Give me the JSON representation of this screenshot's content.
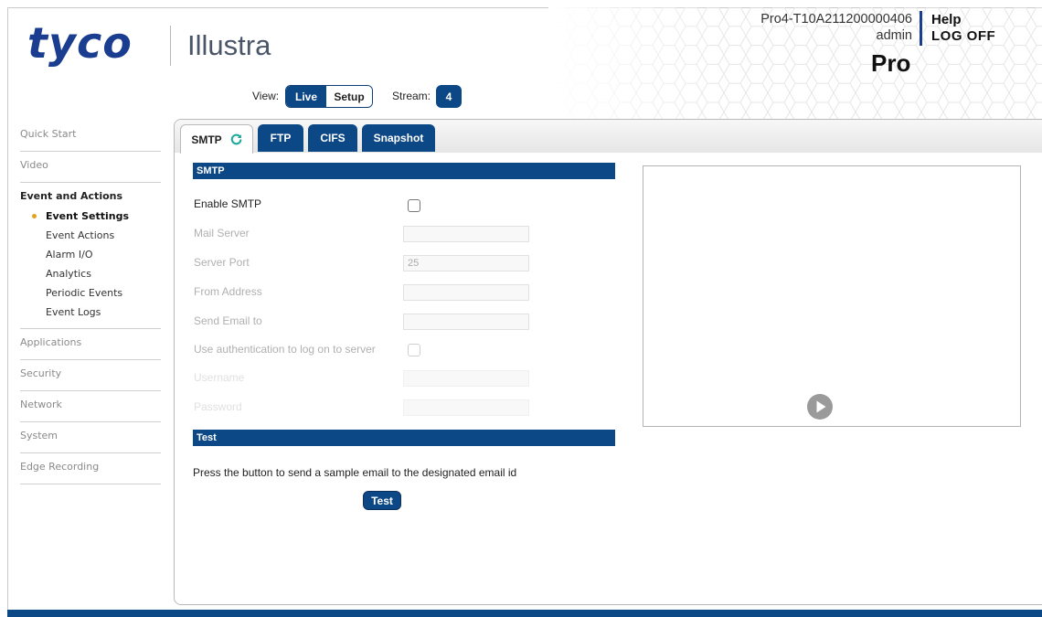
{
  "header": {
    "brand_logo": "tyco",
    "product_logo": "Illustra",
    "device_id": "Pro4-T10A211200000406",
    "username": "admin",
    "help_label": "Help",
    "logoff_label": "LOG OFF",
    "model_label": "Pro"
  },
  "toolbar": {
    "view_label": "View:",
    "live_label": "Live",
    "setup_label": "Setup",
    "view_selected": "Live",
    "stream_label": "Stream:",
    "stream_value": "4"
  },
  "sidebar": {
    "items_top": [
      {
        "label": "Quick Start"
      },
      {
        "label": "Video"
      }
    ],
    "active_section": "Event and Actions",
    "sub_items": [
      {
        "label": "Event Settings",
        "current": true
      },
      {
        "label": "Event Actions"
      },
      {
        "label": "Alarm I/O"
      },
      {
        "label": "Analytics"
      },
      {
        "label": "Periodic Events"
      },
      {
        "label": "Event Logs"
      }
    ],
    "items_bottom": [
      {
        "label": "Applications"
      },
      {
        "label": "Security"
      },
      {
        "label": "Network"
      },
      {
        "label": "System"
      },
      {
        "label": "Edge Recording"
      }
    ]
  },
  "tabs": [
    {
      "label": "SMTP",
      "active": true
    },
    {
      "label": "FTP"
    },
    {
      "label": "CIFS"
    },
    {
      "label": "Snapshot"
    }
  ],
  "smtp_form": {
    "section_title": "SMTP",
    "enable_label": "Enable SMTP",
    "enable_checked": false,
    "mail_server_label": "Mail Server",
    "mail_server_value": "",
    "server_port_label": "Server Port",
    "server_port_value": "25",
    "from_address_label": "From Address",
    "from_address_value": "",
    "send_email_label": "Send Email to",
    "send_email_value": "",
    "auth_label": "Use authentication to log on to server",
    "auth_checked": false,
    "username_label": "Username",
    "username_value": "",
    "password_label": "Password",
    "password_value": ""
  },
  "test_section": {
    "title": "Test",
    "description": "Press the button to send a sample email to the designated email id",
    "button_label": "Test"
  },
  "colors": {
    "brand_blue": "#0d4886",
    "logo_blue": "#1a3d8f",
    "active_bullet": "#e5a21c",
    "refresh_icon": "#1aa99a"
  },
  "icons": {
    "refresh": "refresh-icon",
    "play": "play-icon"
  }
}
